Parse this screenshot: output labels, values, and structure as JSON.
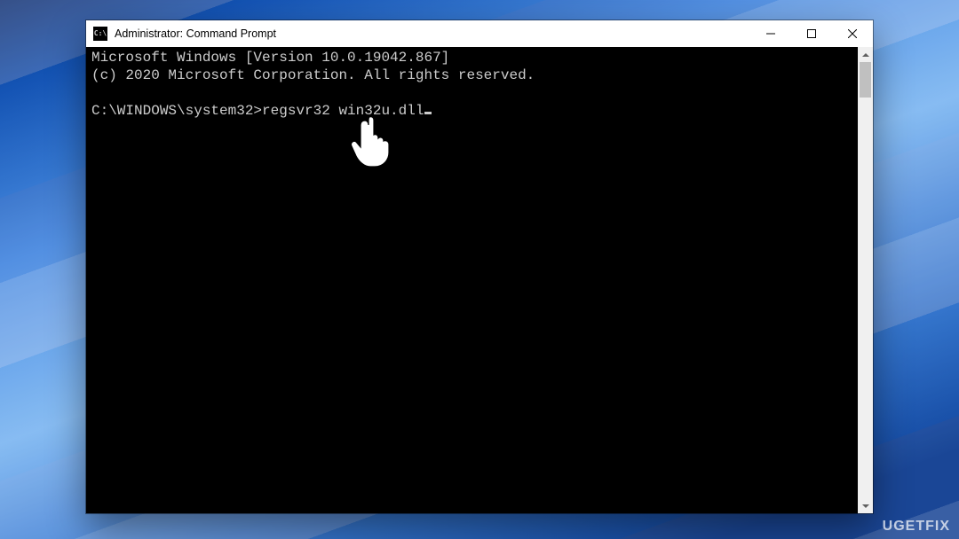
{
  "window": {
    "title": "Administrator: Command Prompt",
    "icon_text": "C:\\"
  },
  "terminal": {
    "line1": "Microsoft Windows [Version 10.0.19042.867]",
    "line2": "(c) 2020 Microsoft Corporation. All rights reserved.",
    "prompt": "C:\\WINDOWS\\system32>",
    "command": "regsvr32 win32u.dll"
  },
  "watermark": "UGETFIX"
}
